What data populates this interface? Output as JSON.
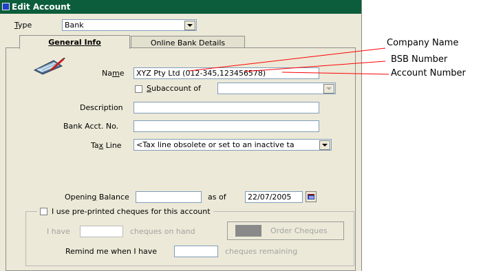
{
  "window": {
    "title": "Edit Account"
  },
  "type": {
    "label": "Type",
    "value": "Bank"
  },
  "tabs": [
    {
      "label": "General Info",
      "active": true
    },
    {
      "label": "Online Bank Details",
      "active": false
    }
  ],
  "form": {
    "name_label": "Name",
    "name_value": "XYZ Pty Ltd (012-345,123456578)",
    "subaccount_label": "Subaccount of",
    "description_label": "Description",
    "bank_acct_label": "Bank Acct. No.",
    "tax_line_label": "Tax Line",
    "tax_line_value": "<Tax line obsolete or set to an inactive ta",
    "opening_balance_label": "Opening Balance",
    "as_of_label": "as of",
    "as_of_date": "22/07/2005"
  },
  "cheques": {
    "group_label": "I use pre-printed cheques for this account",
    "i_have_label": "I have",
    "on_hand_label": "cheques on hand",
    "order_button": "Order Cheques",
    "remind_label": "Remind me when I have",
    "remaining_label": "cheques remaining"
  },
  "callouts": {
    "company_name": "Company Name",
    "bsb_number": "BSB Number",
    "account_number": "Account Number"
  },
  "colors": {
    "titlebar": "#0c5d3b",
    "dialog_bg": "#ece9d8",
    "callout_line": "#ff0000"
  }
}
